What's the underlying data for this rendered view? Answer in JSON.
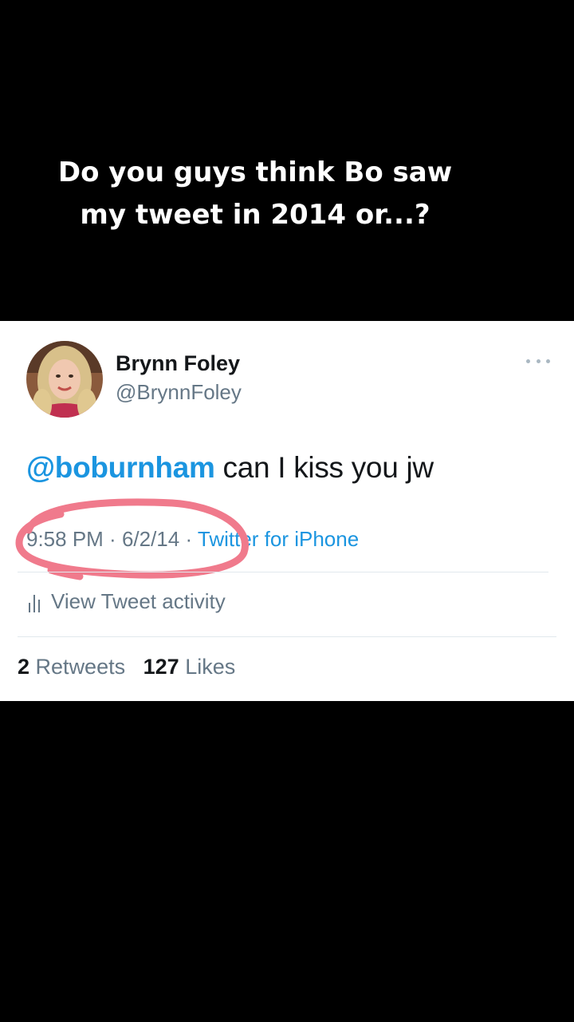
{
  "caption": {
    "line1": "Do you guys think Bo saw",
    "line2": "my tweet in 2014 or...?"
  },
  "tweet": {
    "display_name": "Brynn Foley",
    "handle": "@BrynnFoley",
    "mention": "@boburnham",
    "text": " can I kiss you jw",
    "time": "9:58 PM",
    "date": "6/2/14",
    "separator": " · ",
    "source": "Twitter for iPhone",
    "activity_label": "View Tweet activity",
    "retweets_count": "2",
    "retweets_label": "Retweets",
    "likes_count": "127",
    "likes_label": "Likes"
  },
  "colors": {
    "link": "#1b95e0",
    "secondary_text": "#657786",
    "highlight_circle": "#f07a8c"
  },
  "icons": {
    "more": "more-horizontal-icon",
    "activity": "bar-chart-icon",
    "avatar": "profile-photo"
  }
}
